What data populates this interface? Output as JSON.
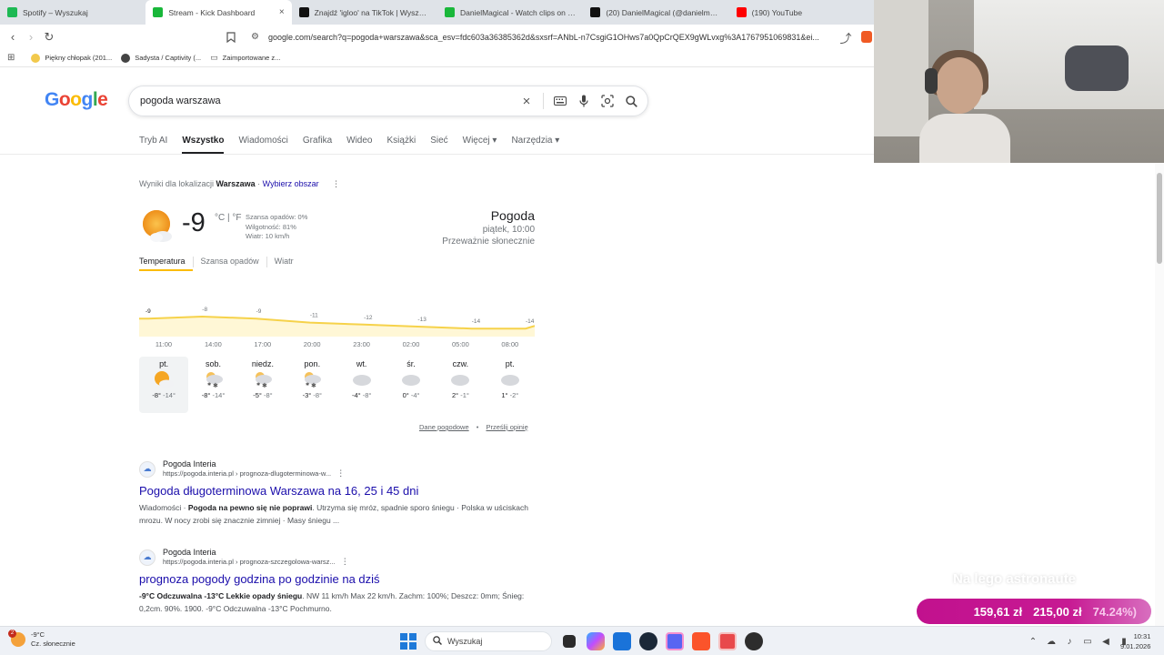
{
  "tabs": [
    {
      "title": "Spotify – Wyszukaj",
      "color": "#1db954",
      "active": false
    },
    {
      "title": "Stream - Kick Dashboard",
      "color": "#19b73a",
      "active": true
    },
    {
      "title": "Znajdź 'igloo' na TikTok | Wyszukiwa",
      "color": "#111111",
      "active": false
    },
    {
      "title": "DanielMagical - Watch clips on Kick",
      "color": "#19b73a",
      "active": false
    },
    {
      "title": "(20) DanielMagical (@danielmagical",
      "color": "#111111",
      "active": false
    },
    {
      "title": "(190) YouTube",
      "color": "#ff0000",
      "active": false
    }
  ],
  "toolbar": {
    "url": "google.com/search?q=pogoda+warszawa&sca_esv=fdc603a36385362d&sxsrf=ANbL-n7CsgiG1OHws7a0QpCrQEX9gWLvxg%3A1767951069831&ei..."
  },
  "bookmarks": [
    {
      "label": "Piękny chłopak (201...",
      "color": "#f2c94c"
    },
    {
      "label": "Sadysta / Captivity (...",
      "color": "#444444"
    },
    {
      "label": "Zaimportowane z...",
      "color": "#888888"
    }
  ],
  "google": {
    "logo": "Google",
    "query": "pogoda warszawa"
  },
  "nav_tabs": [
    {
      "label": "Tryb AI",
      "active": false
    },
    {
      "label": "Wszystko",
      "active": true
    },
    {
      "label": "Wiadomości",
      "active": false
    },
    {
      "label": "Grafika",
      "active": false
    },
    {
      "label": "Wideo",
      "active": false
    },
    {
      "label": "Książki",
      "active": false
    },
    {
      "label": "Sieć",
      "active": false
    },
    {
      "label": "Więcej ▾",
      "active": false
    },
    {
      "label": "Narzędzia ▾",
      "active": false
    }
  ],
  "location": {
    "prefix": "Wyniki dla lokalizacji",
    "city": "Warszawa",
    "change": "Wybierz obszar"
  },
  "weather": {
    "temp": "-9",
    "units": "°C | °F",
    "precip": "Szansa opadów: 0%",
    "humidity": "Wilgotność: 81%",
    "wind": "Wiatr: 10 km/h",
    "title": "Pogoda",
    "time": "piątek, 10:00",
    "condition": "Przeważnie słonecznie",
    "tabs": [
      "Temperatura",
      "Szansa opadów",
      "Wiatr"
    ],
    "graph_values": [
      -9,
      -8,
      -9,
      -11,
      -12,
      -13,
      -14,
      -14
    ],
    "hours": [
      "11:00",
      "14:00",
      "17:00",
      "20:00",
      "23:00",
      "02:00",
      "05:00",
      "08:00"
    ],
    "days": [
      {
        "name": "pt.",
        "hi": "-8°",
        "lo": "-14°",
        "icon": "sun-cloud"
      },
      {
        "name": "sob.",
        "hi": "-8°",
        "lo": "-14°",
        "icon": "snow-cloud"
      },
      {
        "name": "niedz.",
        "hi": "-5°",
        "lo": "-8°",
        "icon": "snow-cloud"
      },
      {
        "name": "pon.",
        "hi": "-3°",
        "lo": "-8°",
        "icon": "snow-cloud"
      },
      {
        "name": "wt.",
        "hi": "-4°",
        "lo": "-8°",
        "icon": "cloud"
      },
      {
        "name": "śr.",
        "hi": "0°",
        "lo": "-4°",
        "icon": "cloud"
      },
      {
        "name": "czw.",
        "hi": "2°",
        "lo": "-1°",
        "icon": "cloud"
      },
      {
        "name": "pt.",
        "hi": "1°",
        "lo": "-2°",
        "icon": "cloud"
      }
    ],
    "footer_data": "Dane pogodowe",
    "footer_feedback": "Prześlij opinię"
  },
  "results": [
    {
      "site": "Pogoda Interia",
      "url": "https://pogoda.interia.pl › prognoza-dlugoterminowa-w...",
      "title": "Pogoda długoterminowa Warszawa na 16, 25 i 45 dni",
      "snippet_a": "Wiadomości · ",
      "snippet_b": "Pogoda na pewno się nie poprawi",
      "snippet_c": ". Utrzyma się mróz, spadnie sporo śniegu · Polska w uściskach mrozu. W nocy zrobi się znacznie zimniej · Masy śniegu ..."
    },
    {
      "site": "Pogoda Interia",
      "url": "https://pogoda.interia.pl › prognoza-szczegolowa-warsz...",
      "title": "prognoza pogody godzina po godzinie na dziś",
      "snippet_a": "",
      "snippet_b": "-9°C Odczuwalna -13°C Lekkie opady śniegu",
      "snippet_c": ". NW 11 km/h Max 22 km/h. Zachm: 100%; Deszcz: 0mm; Śnieg: 0,2cm. 90%. 1900. -9°C Odczuwalna -13°C Pochmurno."
    }
  ],
  "overlay": {
    "text": "Na lego astronaute",
    "amount1": "159,61 zł",
    "amount2": "215,00 zł",
    "percent": "74.24%)"
  },
  "taskbar": {
    "weather_temp": "-9°C",
    "weather_cond": "Cz. słonecznie",
    "weather_badge": "2",
    "search": "Wyszukaj",
    "time": "10:31",
    "date": "9.01.2026"
  }
}
